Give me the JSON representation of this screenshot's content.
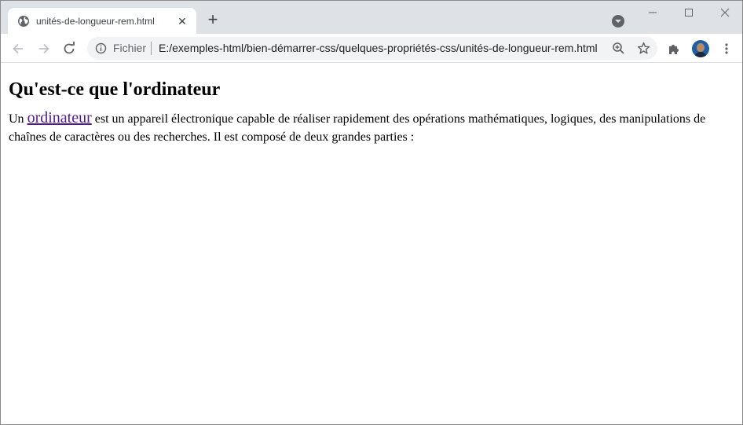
{
  "tab": {
    "title": "unités-de-longueur-rem.html",
    "close_symbol": "✕",
    "favicon": "globe-icon"
  },
  "new_tab_symbol": "+",
  "window_controls": [
    "minimize-icon",
    "maximize-icon",
    "close-icon"
  ],
  "toolbar": {
    "back": "back-arrow-icon",
    "forward": "forward-arrow-icon",
    "reload": "reload-icon",
    "scheme_label": "Fichier",
    "url": "E:/exemples-html/bien-démarrer-css/quelques-propriétés-css/unités-de-longueur-rem.html",
    "zoom": "zoom-icon",
    "bookmark": "star-icon",
    "extensions": "puzzle-icon",
    "menu": "kebab-menu-icon"
  },
  "page": {
    "heading": "Qu'est-ce que l'ordinateur",
    "paragraph_prefix": "Un ",
    "link_text": "ordinateur",
    "paragraph_rest": " est un appareil électronique capable de réaliser rapidement des opérations mathématiques, logiques, des manipulations de chaînes de caractères ou des recherches. Il est composé de deux grandes parties :"
  },
  "colors": {
    "tabstrip_bg": "#dee1e6",
    "omnibox_bg": "#f1f3f4",
    "visited_link": "#551a8b"
  }
}
